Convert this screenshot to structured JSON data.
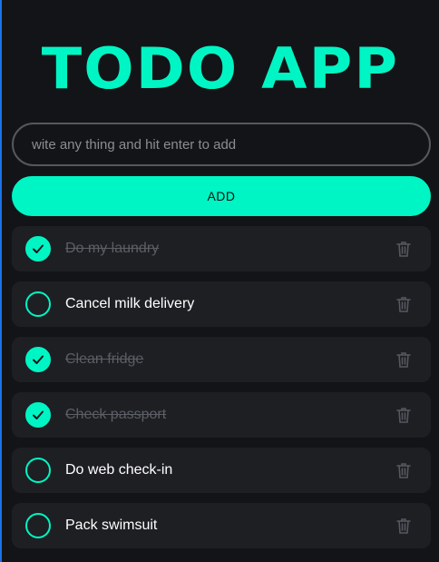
{
  "app": {
    "title": "TODO APP",
    "accent_color": "#00f5c4",
    "background_color": "#131417",
    "card_color": "#1e1f23"
  },
  "input": {
    "placeholder": "wite any thing and hit enter to add",
    "value": ""
  },
  "add_button": {
    "label": "ADD"
  },
  "todos": [
    {
      "text": "Do my laundry",
      "completed": true,
      "check_icon": "check-icon",
      "delete_icon": "trash-icon"
    },
    {
      "text": "Cancel milk delivery",
      "completed": false,
      "check_icon": "circle-icon",
      "delete_icon": "trash-icon"
    },
    {
      "text": "Clean fridge",
      "completed": true,
      "check_icon": "check-icon",
      "delete_icon": "trash-icon"
    },
    {
      "text": "Check passport",
      "completed": true,
      "check_icon": "check-icon",
      "delete_icon": "trash-icon"
    },
    {
      "text": "Do web check-in",
      "completed": false,
      "check_icon": "circle-icon",
      "delete_icon": "trash-icon"
    },
    {
      "text": "Pack swimsuit",
      "completed": false,
      "check_icon": "circle-icon",
      "delete_icon": "trash-icon"
    }
  ]
}
